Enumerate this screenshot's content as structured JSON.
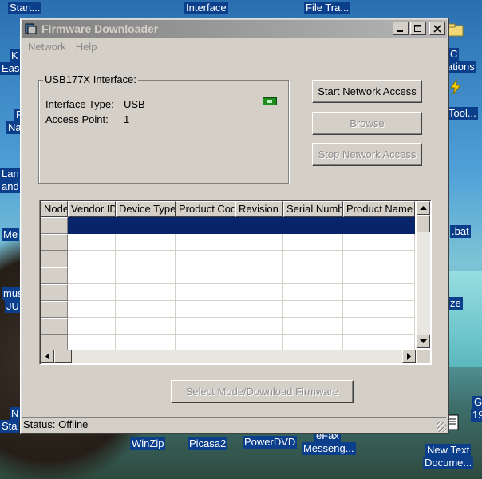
{
  "desktop": {
    "labels": {
      "start": "Start...",
      "interface": "Interface",
      "file_transfer": "File Tra...",
      "k": "K",
      "eas": "Eas",
      "f": "F",
      "na": "Na",
      "lan": "Lan",
      "and": "and",
      "med": "Me",
      "mus": "mus",
      "ju": "JU",
      "n": "N",
      "sta": "Sta",
      "c_right": "C",
      "ations": "ations",
      "tool": "Tool...",
      "bat": ".bat",
      "ze": "ze",
      "winzip": "WinZip",
      "picasa": "Picasa2",
      "powerdvd": "PowerDVD",
      "efax": "eFax",
      "messenger": "Messeng...",
      "newtext1": "New Text",
      "newtext2": "Docume...",
      "g": "G",
      "num19": "19"
    }
  },
  "window": {
    "title": "Firmware Downloader",
    "menu": [
      "Network",
      "Help"
    ],
    "group": {
      "title": "USB177X Interface:",
      "interface_type_label": "Interface Type:",
      "interface_type_value": "USB",
      "access_point_label": "Access Point:",
      "access_point_value": "1"
    },
    "buttons": {
      "start": "Start Network Access",
      "browse": "Browse",
      "stop": "Stop Network Access",
      "select_mode": "Select Mode/Download Firmware"
    },
    "table": {
      "columns": [
        "Node",
        "Vendor ID",
        "Device Type",
        "Product Code",
        "Revision",
        "Serial Number",
        "Product Name"
      ]
    },
    "status": "Status: Offline"
  },
  "colors": {
    "selection": "#0a246a",
    "window_face": "#d4d0c8",
    "titlebar_inactive": "#808080"
  }
}
